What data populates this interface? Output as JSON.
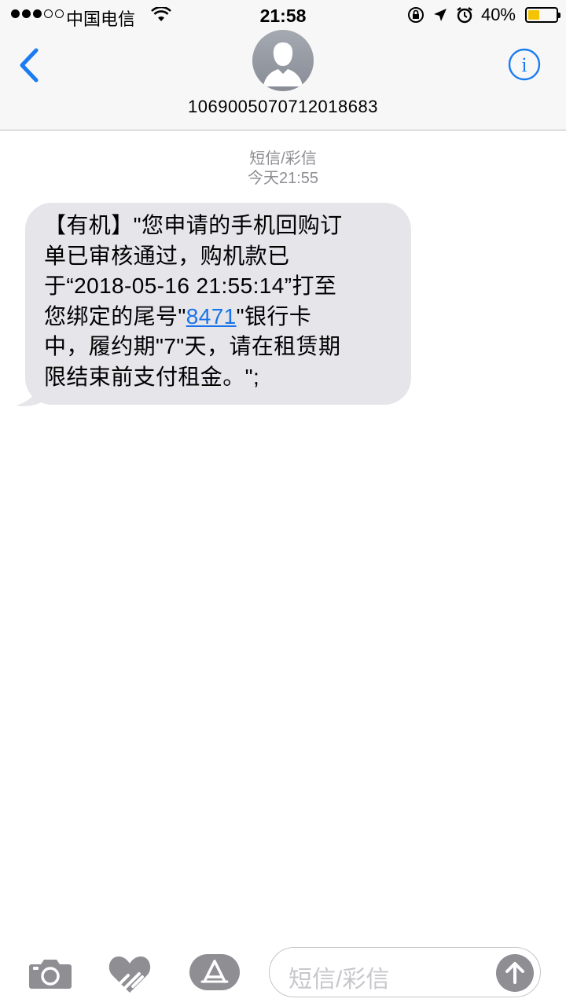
{
  "status_bar": {
    "carrier": "中国电信",
    "time": "21:58",
    "battery_percent": "40%",
    "battery_level": 0.4,
    "signal_strength": 3
  },
  "nav": {
    "contact_number": "1069005070712018683",
    "back_icon": "chevron-left-icon",
    "info_icon": "info-icon",
    "avatar_icon": "person-avatar-icon"
  },
  "conversation": {
    "service_label": "短信/彩信",
    "timestamp": "今天21:55",
    "message": {
      "line1": "【有机】\"您申请的手机回购订",
      "line2": "单已审核通过，购机款已",
      "line3": "于“2018-05-16 21:55:14”打至",
      "line4_before": "您绑定的尾号\"",
      "line4_link": "8471",
      "line4_after": "\"银行卡",
      "line5": "中，履约期\"7\"天，请在租赁期",
      "line6": "限结束前支付租金。\";"
    }
  },
  "composer": {
    "placeholder": "短信/彩信",
    "camera_icon": "camera-icon",
    "digital_touch_icon": "digital-touch-heart-icon",
    "app_store_icon": "app-store-icon",
    "send_icon": "send-arrow-up-icon"
  },
  "colors": {
    "accent": "#1a7cf0",
    "bubble": "#e5e5ea",
    "meta_text": "#8e8e93",
    "icon_gray": "#8e8e93",
    "battery": "#f5c400"
  }
}
